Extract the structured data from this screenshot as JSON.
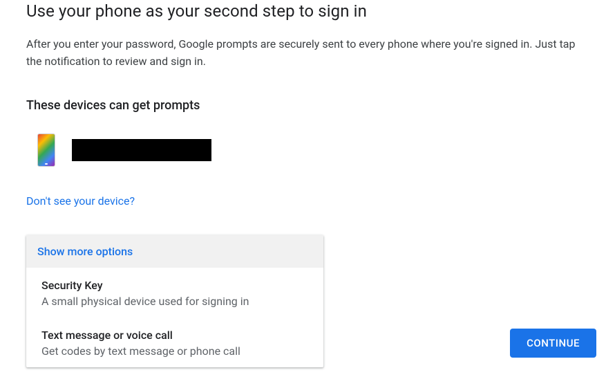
{
  "header": {
    "title": "Use your phone as your second step to sign in",
    "description": "After you enter your password, Google prompts are securely sent to every phone where you're signed in. Just tap the notification to review and sign in."
  },
  "devices": {
    "heading": "These devices can get prompts",
    "items": [
      {
        "name": "[redacted device name]"
      }
    ],
    "not_found_link": "Don't see your device?"
  },
  "options": {
    "expand_label": "Show more options",
    "items": [
      {
        "title": "Security Key",
        "desc": "A small physical device used for signing in"
      },
      {
        "title": "Text message or voice call",
        "desc": "Get codes by text message or phone call"
      }
    ]
  },
  "actions": {
    "continue": "CONTINUE"
  }
}
